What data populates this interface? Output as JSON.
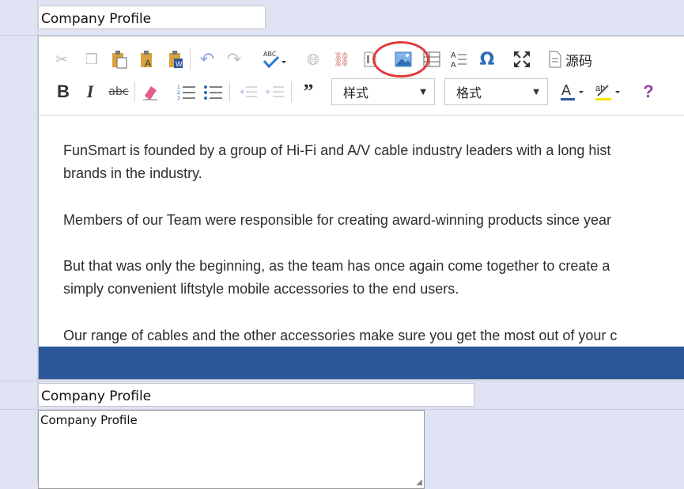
{
  "fields": {
    "title_top": "Company Profile",
    "title_bottom": "Company Profile",
    "textarea_value": "Company Profile"
  },
  "toolbar": {
    "source_label": "源码",
    "style_combo": "样式",
    "format_combo": "格式",
    "help_label": "?",
    "spellcheck_label": "ABC",
    "icons": [
      "cut-icon",
      "copy-icon",
      "paste-icon",
      "paste-text-icon",
      "paste-word-icon",
      "undo-icon",
      "redo-icon",
      "spellcheck-icon",
      "link-icon",
      "unlink-icon",
      "anchor-icon",
      "image-icon",
      "table-icon",
      "hr-icon",
      "special-char-icon",
      "maximize-icon",
      "source-icon",
      "bold-icon",
      "italic-icon",
      "strike-icon",
      "remove-format-icon",
      "numbered-list-icon",
      "bulleted-list-icon",
      "outdent-icon",
      "indent-icon",
      "blockquote-icon",
      "text-color-icon",
      "bg-color-icon",
      "help-icon"
    ]
  },
  "content": {
    "p1_line1": "FunSmart is founded by a group of Hi-Fi and A/V cable industry leaders with a long hist",
    "p1_line2": "brands in the industry.",
    "p2_line1": "Members of our Team were responsible for creating award-winning products since year",
    "p3_line1": "But that was only the beginning, as the team has once again come together to create a",
    "p3_line2": "simply convenient liftstyle mobile accessories to the end users.",
    "p4_line1": "Our range of cables and the other accessories make sure you get the most out of your c"
  },
  "colors": {
    "statusbar": "#2b579a",
    "highlight_circle": "#e33a3a",
    "help": "#8e44ad",
    "text_color_bar": "#2b579a",
    "bg_color_bar": "#f2e600"
  }
}
